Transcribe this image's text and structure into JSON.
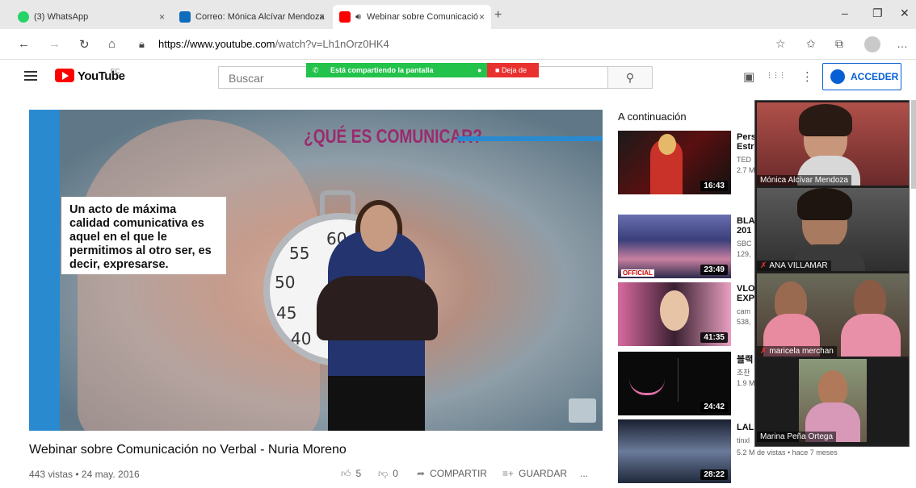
{
  "browser": {
    "tabs": [
      {
        "label": "(3) WhatsApp",
        "close": "×"
      },
      {
        "label": "Correo: Mónica Alcívar Mendoza",
        "close": "×"
      },
      {
        "label": "Webinar sobre Comunicació",
        "close": "×"
      }
    ],
    "new_tab": "+",
    "window": {
      "minimize": "–",
      "maximize": "❐",
      "close": "✕"
    },
    "nav": {
      "back": "←",
      "forward": "→",
      "reload": "↻",
      "home": "⌂"
    },
    "url_host": "https://www.youtube.com",
    "url_path": "/watch?v=Lh1nOrz0HK4",
    "tools": {
      "favorite": "☆",
      "favorites_bar": "✩",
      "collections": "⧉",
      "more": "…"
    }
  },
  "youtube": {
    "logo_text": "YouTube",
    "country": "EC",
    "search_placeholder": "Buscar",
    "search_icon": "⚲",
    "sharing_banner": "Está compartiendo la pantalla",
    "stop_sharing": "Deja de",
    "create_icon": "▣",
    "apps_icon": "⋮⋮⋮",
    "settings_icon": "⋮",
    "signin_label": "ACCEDER"
  },
  "video": {
    "overlay_title": "¿QUÉ ES COMUNICAR?",
    "quote": "Un acto de máxima calidad comunicativa es aquel en el que le permitimos al otro ser, es decir, expresarse.",
    "title": "Webinar sobre Comunicación no Verbal - Nuria Moreno",
    "meta": "443 vistas • 24 may. 2016",
    "likes": "5",
    "dislikes": "0",
    "share_label": "COMPARTIR",
    "save_label": "GUARDAR",
    "more": "..."
  },
  "sidebar": {
    "next_label": "A continuación",
    "items": [
      {
        "title": "Pers",
        "title2": "Estr",
        "channel": "TED",
        "meta": "2.7 M",
        "duration": "16:43"
      },
      {
        "title": "BLA",
        "title2": "201",
        "channel": "SBC",
        "meta": "129,",
        "duration": "23:49",
        "badge": "OFFICIAL"
      },
      {
        "title": "VLO",
        "title2": "EXP",
        "channel": "cam",
        "meta": "538,",
        "duration": "41:35"
      },
      {
        "title": "블랙",
        "title2": "",
        "channel": "조찬",
        "meta": "1.9 M",
        "duration": "24:42"
      },
      {
        "title": "LAL",
        "title2": "",
        "channel": "tinxl",
        "meta": "5.2 M de vistas • hace 7 meses",
        "duration": "28:22"
      }
    ]
  },
  "meeting": {
    "participants": [
      {
        "name": "Mónica Alcívar Mendoza",
        "muted": false
      },
      {
        "name": "ANA VILLAMAR",
        "muted": true
      },
      {
        "name": "maricela merchan",
        "muted": true
      },
      {
        "name": "Marina Peña Ortega",
        "muted": false
      }
    ]
  },
  "colors": {
    "yt_red": "#ff0000",
    "link_blue": "#065fd4",
    "share_green": "#23c24a",
    "stop_red": "#e8312f"
  }
}
